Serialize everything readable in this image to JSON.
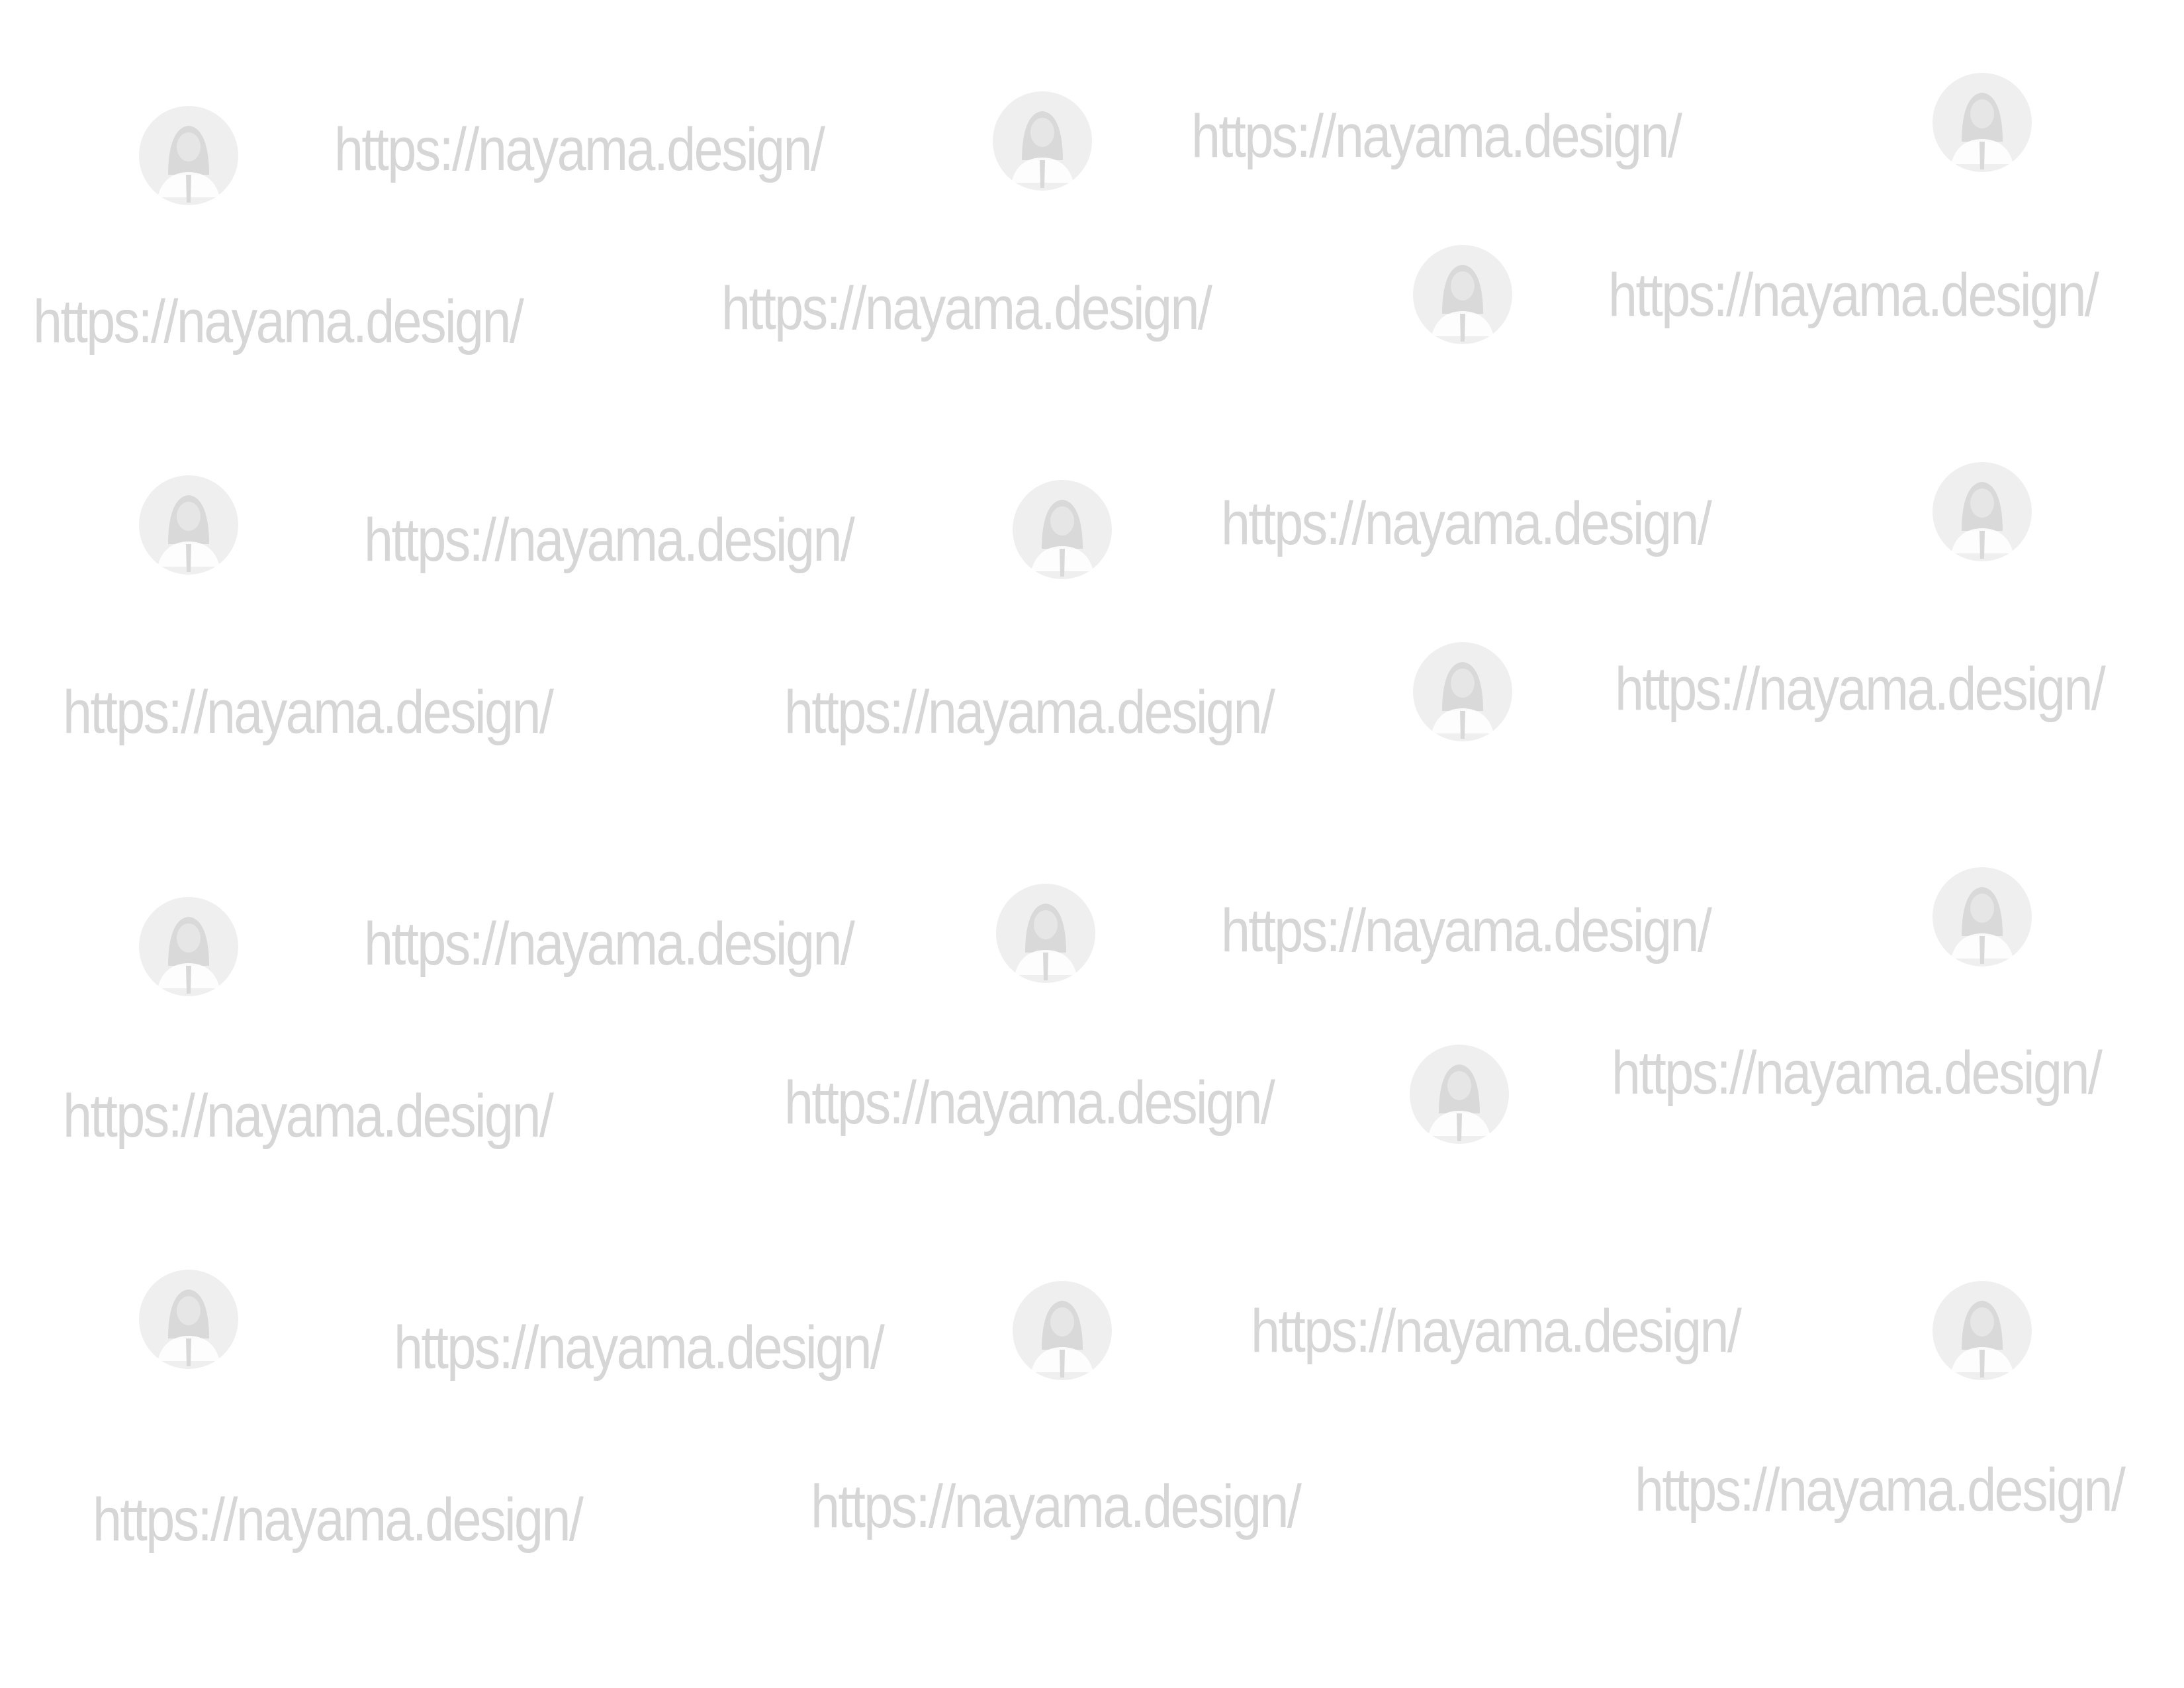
{
  "watermark": {
    "text": "https://nayama.design/",
    "logo_icon": "woman-avatar-icon",
    "text_color": "#d6d6d6",
    "logo_circle_color": "#efefef",
    "logo_figure_color": "#d9d9d9",
    "background_color": "#ffffff"
  }
}
